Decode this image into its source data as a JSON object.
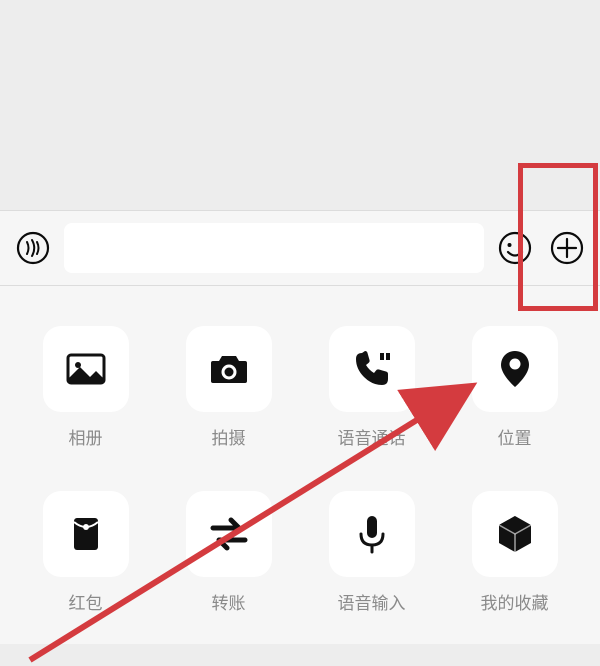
{
  "input": {
    "placeholder": ""
  },
  "attachments": [
    {
      "name": "album",
      "label": "相册"
    },
    {
      "name": "camera",
      "label": "拍摄"
    },
    {
      "name": "voicecall",
      "label": "语音通话"
    },
    {
      "name": "location",
      "label": "位置"
    },
    {
      "name": "redpacket",
      "label": "红包"
    },
    {
      "name": "transfer",
      "label": "转账"
    },
    {
      "name": "voicein",
      "label": "语音输入"
    },
    {
      "name": "favorite",
      "label": "我的收藏"
    }
  ],
  "annotation": {
    "highlight_target": "plus-button",
    "arrow_target": "location"
  }
}
